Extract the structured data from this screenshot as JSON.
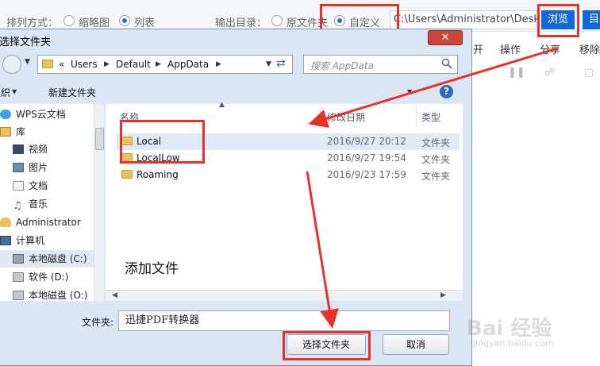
{
  "app": {
    "sort_label": "排列方式：",
    "sort_options": [
      "缩略图",
      "列表"
    ],
    "output_label": "输出目录：",
    "output_options": [
      "原文件夹",
      "自定义"
    ],
    "output_path": "C:\\Users\\Administrator\\Deskto",
    "browse_label": "浏览",
    "edge_button_label": "目",
    "column_heads": [
      "开",
      "操作",
      "分享",
      "移除"
    ]
  },
  "dialog": {
    "title": "选择文件夹",
    "close_label": "✕",
    "address": {
      "prefix": "«",
      "crumbs": [
        "Users",
        "Default",
        "AppData"
      ]
    },
    "search_placeholder": "搜索 AppData",
    "commands": {
      "organize": "组织",
      "new_folder": "新建文件夹"
    },
    "nav_items": [
      {
        "label": "WPS云文档",
        "icon": "cloud-icon"
      },
      {
        "label": "库",
        "icon": "library-icon"
      },
      {
        "label": "视频",
        "icon": "video-icon"
      },
      {
        "label": "图片",
        "icon": "picture-icon"
      },
      {
        "label": "文档",
        "icon": "document-icon"
      },
      {
        "label": "音乐",
        "icon": "music-icon"
      },
      {
        "label": "Administrator",
        "icon": "user-icon"
      },
      {
        "label": "计算机",
        "icon": "computer-icon"
      },
      {
        "label": "本地磁盘 (C:)",
        "icon": "drive-icon"
      },
      {
        "label": "软件 (D:)",
        "icon": "drive-icon"
      },
      {
        "label": "本地磁盘 (O:)",
        "icon": "drive-icon"
      }
    ],
    "columns": {
      "name": "名称",
      "date": "修改日期",
      "type": "类型"
    },
    "files": [
      {
        "name": "Local",
        "date": "2016/9/27 20:12",
        "type": "文件夹"
      },
      {
        "name": "LocalLow",
        "date": "2016/9/27 19:54",
        "type": "文件夹"
      },
      {
        "name": "Roaming",
        "date": "2016/9/23 17:59",
        "type": "文件夹"
      }
    ],
    "annotation": "添加文件",
    "folder_label": "文件夹:",
    "folder_value": "迅捷PDF转换器",
    "select_button": "选择文件夹",
    "cancel_button": "取消"
  },
  "colors": {
    "annotation_red": "#e8312a",
    "accent_blue": "#1468d6"
  },
  "watermark": {
    "logo": "Bai 经验",
    "url": "jingyan.baidu.com"
  }
}
